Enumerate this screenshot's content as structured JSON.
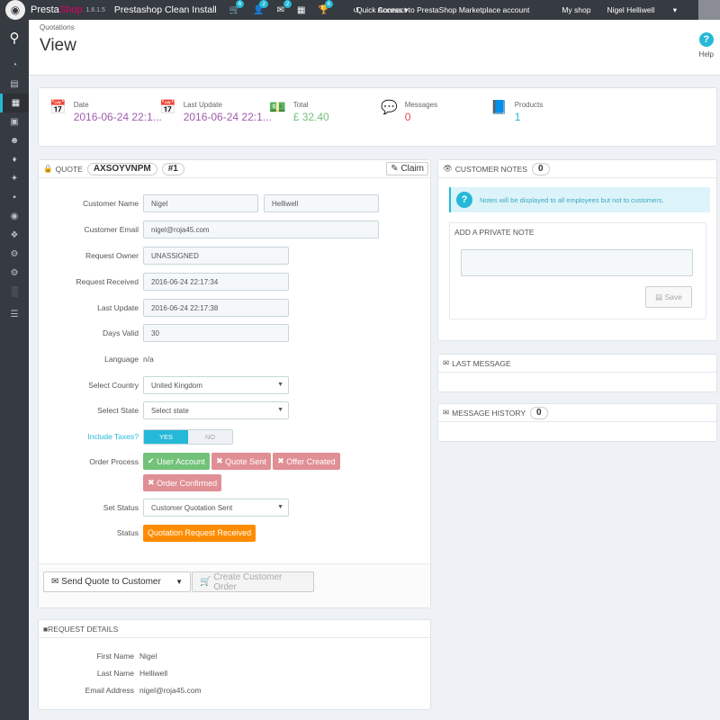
{
  "topbar": {
    "brand_a": "Presta",
    "brand_b": "Shop",
    "version": "1.6.1.5",
    "shop_name": "Prestashop Clean Install",
    "badges": {
      "orders": "6",
      "customers": "2",
      "messages": "2",
      "trophy": "6"
    },
    "quick_access": "Quick Access",
    "marketplace": "Connect to PrestaShop Marketplace account",
    "my_shop": "My shop",
    "user": "Nigel Helliwell"
  },
  "header": {
    "breadcrumb": "Quotations",
    "title": "View",
    "help": "Help"
  },
  "kpis": {
    "date": {
      "label": "Date",
      "value": "2016-06-24 22:1..."
    },
    "last_update": {
      "label": "Last Update",
      "value": "2016-06-24 22:1..."
    },
    "total": {
      "label": "Total",
      "value": "£ 32.40"
    },
    "messages": {
      "label": "Messages",
      "value": "0"
    },
    "products": {
      "label": "Products",
      "value": "1"
    }
  },
  "quote": {
    "heading": "QUOTE",
    "reference": "AXSOYVNPM",
    "number": "#1",
    "claim": "Claim",
    "fields": {
      "customer_name_label": "Customer Name",
      "first_name": "Nigel",
      "last_name": "Helliwell",
      "customer_email_label": "Customer Email",
      "customer_email": "nigel@roja45.com",
      "request_owner_label": "Request Owner",
      "request_owner": "UNASSIGNED",
      "request_received_label": "Request Received",
      "request_received": "2016-06-24 22:17:34",
      "last_update_label": "Last Update",
      "last_update": "2016-06-24 22:17:38",
      "days_valid_label": "Days Valid",
      "days_valid": "30",
      "language_label": "Language",
      "language": "n/a",
      "country_label": "Select Country",
      "country": "United Kingdom",
      "state_label": "Select State",
      "state": "Select state",
      "taxes_label": "Include Taxes?",
      "taxes_yes": "YES",
      "taxes_no": "NO",
      "process_label": "Order Process",
      "process": {
        "user_account": "User Account",
        "quote_sent": "Quote Sent",
        "offer_created": "Offer Created",
        "order_confirmed": "Order Confirmed"
      },
      "set_status_label": "Set Status",
      "set_status": "Customer Quotation Sent",
      "status_label": "Status",
      "status": "Quotation Request Received"
    },
    "send_quote": "Send Quote to Customer",
    "create_order": "Create Customer Order"
  },
  "request_details": {
    "heading": "REQUEST DETAILS",
    "first_name_label": "First Name",
    "first_name": "Nigel",
    "last_name_label": "Last Name",
    "last_name": "Helliwell",
    "email_label": "Email Address",
    "email": "nigel@roja45.com"
  },
  "customer_notes": {
    "heading": "CUSTOMER NOTES",
    "count": "0",
    "info": "Notes will be displayed to all employees but not to customers.",
    "private_note_heading": "ADD A PRIVATE NOTE",
    "save": "Save"
  },
  "last_message": {
    "heading": "LAST MESSAGE"
  },
  "message_history": {
    "heading": "MESSAGE HISTORY",
    "count": "0"
  },
  "colors": {
    "accent": "#25b9d7",
    "purple": "#a05cae",
    "green": "#72c279",
    "red": "#e08f95",
    "orange": "#ff8c00",
    "dark": "#363a41"
  }
}
